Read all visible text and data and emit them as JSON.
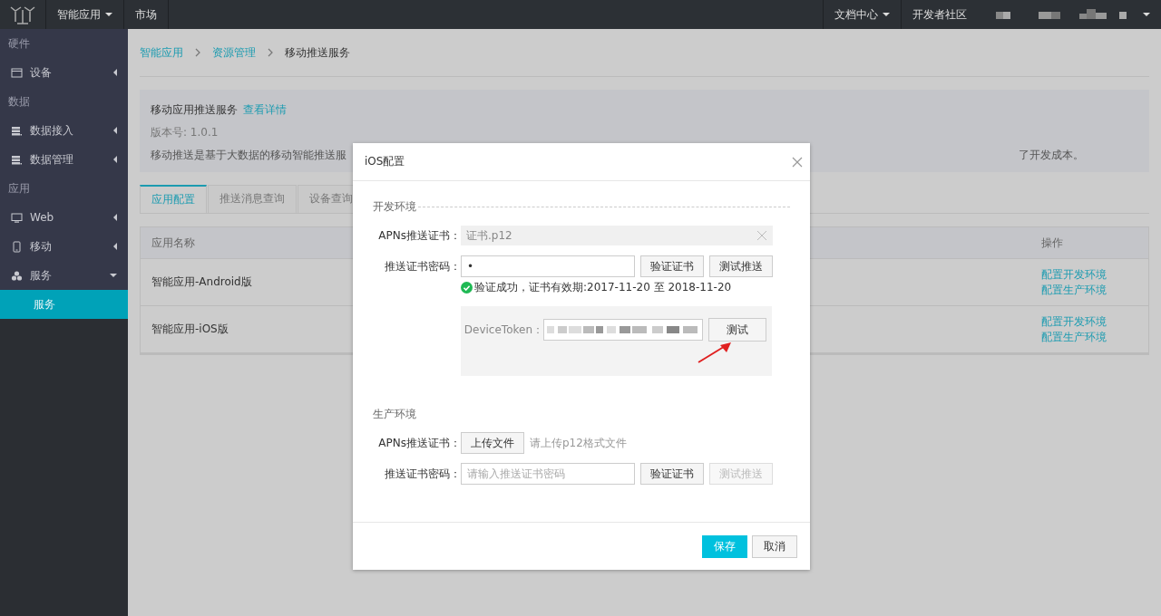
{
  "topbar": {
    "menus": [
      {
        "label": "智能应用",
        "dropdown": true
      },
      {
        "label": "市场",
        "dropdown": false
      }
    ],
    "right_menus": [
      {
        "label": "文档中心",
        "dropdown": true
      },
      {
        "label": "开发者社区",
        "dropdown": false
      }
    ],
    "account": {
      "dropdown": true
    }
  },
  "sidebar": {
    "items": [
      {
        "kind": "group",
        "label": "硬件"
      },
      {
        "kind": "item",
        "label": "设备",
        "expanded": false
      },
      {
        "kind": "group",
        "label": "数据"
      },
      {
        "kind": "item",
        "label": "数据接入",
        "expanded": false
      },
      {
        "kind": "item",
        "label": "数据管理",
        "expanded": false
      },
      {
        "kind": "group",
        "label": "应用"
      },
      {
        "kind": "item",
        "label": "Web",
        "expanded": false
      },
      {
        "kind": "item",
        "label": "移动",
        "expanded": false
      },
      {
        "kind": "item",
        "label": "服务",
        "expanded": true,
        "children": [
          {
            "label": "服务",
            "selected": true
          }
        ]
      }
    ]
  },
  "breadcrumb": [
    {
      "label": "智能应用",
      "link": true
    },
    {
      "label": "资源管理",
      "link": true
    },
    {
      "label": "移动推送服务",
      "link": false
    }
  ],
  "service": {
    "title": "移动应用推送服务",
    "details_link": "查看详情",
    "version": "版本号: 1.0.1",
    "description_start": "移动推送是基于大数据的移动智能推送服",
    "description_end": "了开发成本。"
  },
  "tabs": [
    {
      "label": "应用配置",
      "selected": true
    },
    {
      "label": "推送消息查询",
      "selected": false
    },
    {
      "label": "设备查询",
      "selected": false
    }
  ],
  "table": {
    "columns": [
      {
        "label": "应用名称"
      },
      {
        "label": "操作"
      }
    ],
    "rows": [
      {
        "name": "智能应用-Android版",
        "actions": [
          "配置开发环境",
          "配置生产环境"
        ]
      },
      {
        "name": "智能应用-iOS版",
        "actions": [
          "配置开发环境",
          "配置生产环境"
        ]
      }
    ]
  },
  "dialog": {
    "title": "iOS配置",
    "sections": [
      {
        "title": "开发环境",
        "dashed": true,
        "rows": [
          {
            "kind": "file",
            "label": "APNs推送证书：",
            "value": "证书.p12"
          },
          {
            "kind": "password",
            "label": "推送证书密码：",
            "value": "•",
            "buttons": [
              {
                "label": "验证证书",
                "disabled": false
              },
              {
                "label": "测试推送",
                "disabled": false
              }
            ]
          },
          {
            "kind": "status",
            "success": true,
            "message": "验证成功，证书有效期:2017-11-20 至 2018-11-20"
          },
          {
            "kind": "token",
            "label": "DeviceToken：",
            "button": "测试"
          }
        ]
      },
      {
        "title": "生产环境",
        "dashed": false,
        "rows": [
          {
            "kind": "upload",
            "label": "APNs推送证书：",
            "button": "上传文件",
            "hint": "请上传p12格式文件"
          },
          {
            "kind": "password",
            "label": "推送证书密码：",
            "placeholder": "请输入推送证书密码",
            "buttons": [
              {
                "label": "验证证书",
                "disabled": false
              },
              {
                "label": "测试推送",
                "disabled": true
              }
            ]
          }
        ]
      }
    ],
    "buttons": [
      {
        "label": "保存",
        "primary": true
      },
      {
        "label": "取消",
        "primary": false
      }
    ]
  }
}
